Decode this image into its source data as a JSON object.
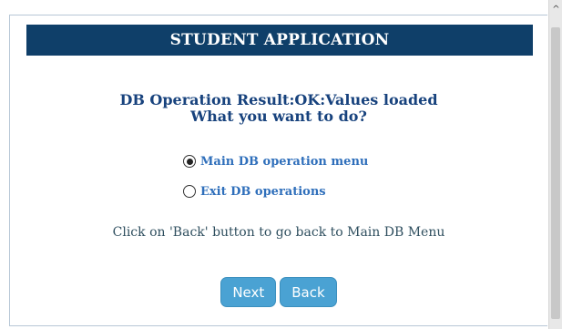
{
  "header": {
    "title": "STUDENT APPLICATION"
  },
  "result": {
    "line1": "DB Operation Result:OK:Values loaded",
    "line2": "What you want to do?"
  },
  "options": [
    {
      "label": "Main DB operation menu",
      "selected": true
    },
    {
      "label": "Exit DB operations",
      "selected": false
    }
  ],
  "hint": "Click on 'Back' button to go back to Main DB Menu",
  "buttons": {
    "next_label": "Next",
    "back_label": "Back"
  },
  "scrollbar": {
    "up_glyph": "^"
  },
  "colors": {
    "header_bg": "#0f3f69",
    "result_text": "#17427d",
    "option_text": "#2f6fbb",
    "button_bg": "#4aa2d3"
  }
}
